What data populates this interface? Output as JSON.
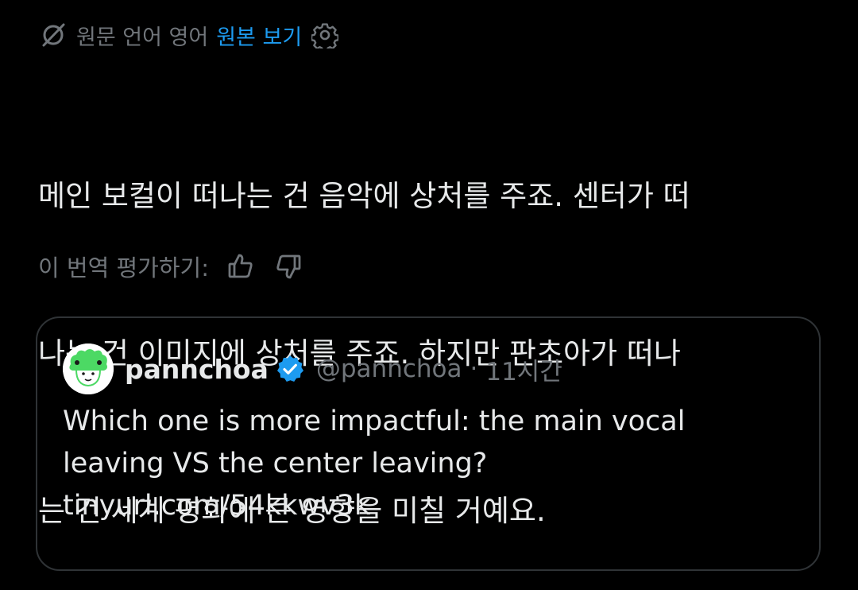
{
  "translation": {
    "source_language_label": "원문 언어 영어",
    "view_original_label": "원본 보기"
  },
  "tweet": {
    "lines": [
      "메인 보컬이 떠나는 건 음악에 상처를 주죠. 센터가 떠",
      "나는 건 이미지에 상처를 주죠. 하지만 판초아가 떠나",
      "는 건 세계 평화에 큰 영향을 미칠 거예요."
    ]
  },
  "rating": {
    "label": "이 번역 평가하기:"
  },
  "quote": {
    "author_name": "pannchoa",
    "handle": "@pannchoa",
    "separator": "·",
    "time": "11시간",
    "lines": [
      "Which one is more impactful: the main vocal",
      "leaving VS the center leaving?",
      "tinyurl.com/54kkwv3k"
    ]
  },
  "colors": {
    "background": "#000000",
    "text": "#e7e9ea",
    "secondary": "#71767b",
    "accent": "#1d9bf0",
    "border": "#2f3336",
    "avatar_green": "#4cd964"
  },
  "icons": [
    "globe-translate-icon",
    "gear-icon",
    "thumbs-up-icon",
    "thumbs-down-icon",
    "verified-badge-icon"
  ]
}
